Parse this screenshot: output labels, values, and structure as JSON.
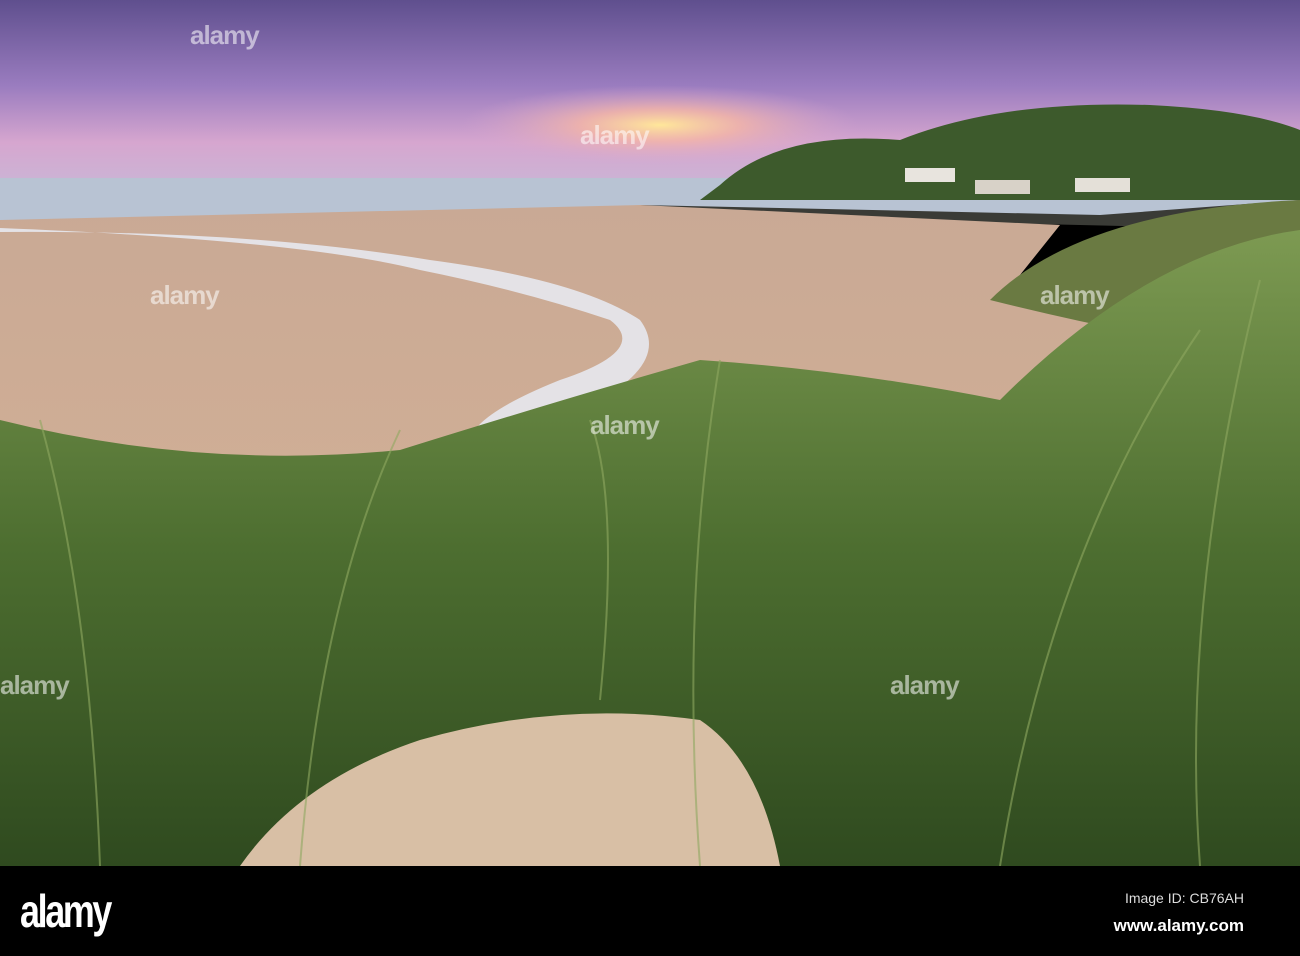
{
  "photo": {
    "subject": "Sand dunes with marram grass overlooking a beach, stream, sea and headland at dusk",
    "colors": {
      "sky_top": "#6f5a9a",
      "sky_glow": "#f3c2a8",
      "sea": "#b9c4d2",
      "sand": "#d9b89a",
      "grass": "#5b7a3a",
      "hill": "#3d5a2c"
    }
  },
  "watermark": {
    "text": "alamy"
  },
  "footer": {
    "logo": "alamy",
    "image_id": "Image ID: CB76AH",
    "url": "www.alamy.com"
  }
}
